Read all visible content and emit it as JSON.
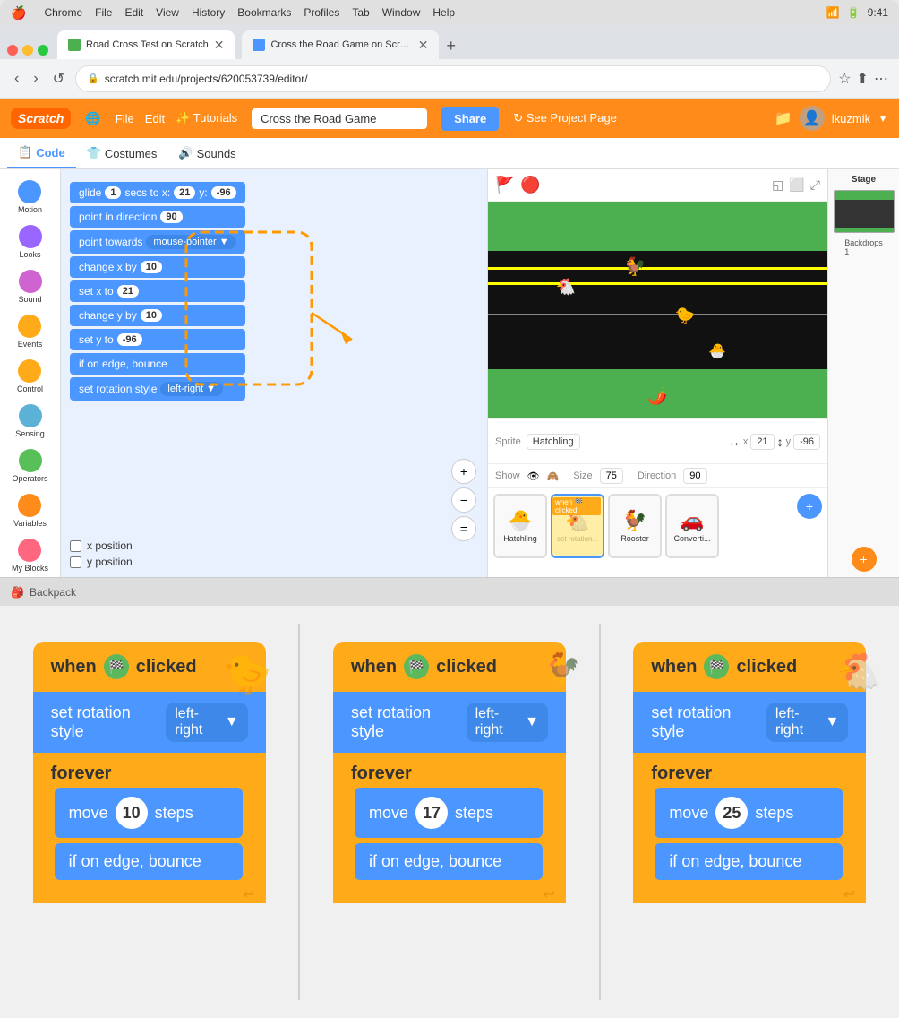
{
  "browser": {
    "menu_items": [
      "Chrome",
      "File",
      "Edit",
      "View",
      "History",
      "Bookmarks",
      "Profiles",
      "Tab",
      "Window",
      "Help"
    ],
    "tabs": [
      {
        "label": "Road Cross Test on Scratch",
        "active": true,
        "favicon_color": "#4CAF50"
      },
      {
        "label": "Cross the Road Game on Scra...",
        "active": false,
        "favicon_color": "#4c97ff"
      }
    ],
    "new_tab_icon": "+",
    "url": "scratch.mit.edu/projects/620053739/editor/",
    "url_lock": "🔒"
  },
  "scratch": {
    "logo": "Scratch",
    "nav": [
      "🌐",
      "File",
      "Edit",
      "✨ Tutorials"
    ],
    "project_name": "Cross the Road Game",
    "share_btn": "Share",
    "see_project_btn": "↻ See Project Page",
    "username": "lkuzmik",
    "tabs": [
      "Code",
      "Costumes",
      "Sounds"
    ],
    "active_tab": "Code"
  },
  "palette": {
    "items": [
      {
        "label": "Motion",
        "color": "#4c97ff"
      },
      {
        "label": "Looks",
        "color": "#9966ff"
      },
      {
        "label": "Sound",
        "color": "#cf63cf"
      },
      {
        "label": "Events",
        "color": "#ffab19"
      },
      {
        "label": "Control",
        "color": "#ffab19"
      },
      {
        "label": "Sensing",
        "color": "#5cb1d6"
      },
      {
        "label": "Operators",
        "color": "#59c059"
      },
      {
        "label": "Variables",
        "color": "#ff8c1a"
      },
      {
        "label": "My Blocks",
        "color": "#ff6680"
      }
    ]
  },
  "code_blocks": [
    "glide 1 secs to x: 21 y: -96",
    "point in direction 90",
    "point towards mouse-pointer",
    "change x by 10",
    "set x to 21",
    "change y by 10",
    "set y to -96",
    "if on edge, bounce",
    "set rotation style left-right"
  ],
  "stage": {
    "sprite_name": "Hatchling",
    "x": "21",
    "y": "-96",
    "size": "75",
    "direction": "90",
    "show": true
  },
  "backpack": "Backpack",
  "zoom_panels": [
    {
      "when_label": "when",
      "clicked_label": "clicked",
      "set_rotation_label": "set rotation style",
      "left_right_label": "left-right",
      "forever_label": "forever",
      "move_label": "move",
      "steps_value": "10",
      "steps_label": "steps",
      "edge_label": "if on edge, bounce",
      "sprite": "🐤"
    },
    {
      "when_label": "when",
      "clicked_label": "clicked",
      "set_rotation_label": "set rotation style",
      "left_right_label": "left-right",
      "forever_label": "forever",
      "move_label": "move",
      "steps_value": "17",
      "steps_label": "steps",
      "edge_label": "if on edge, bounce",
      "sprite": "🐓"
    },
    {
      "when_label": "when",
      "clicked_label": "clicked",
      "set_rotation_label": "set rotation style",
      "left_right_label": "left-right",
      "forever_label": "forever",
      "move_label": "move",
      "steps_value": "25",
      "steps_label": "steps",
      "edge_label": "if on edge, bounce",
      "sprite": "🐔"
    }
  ]
}
